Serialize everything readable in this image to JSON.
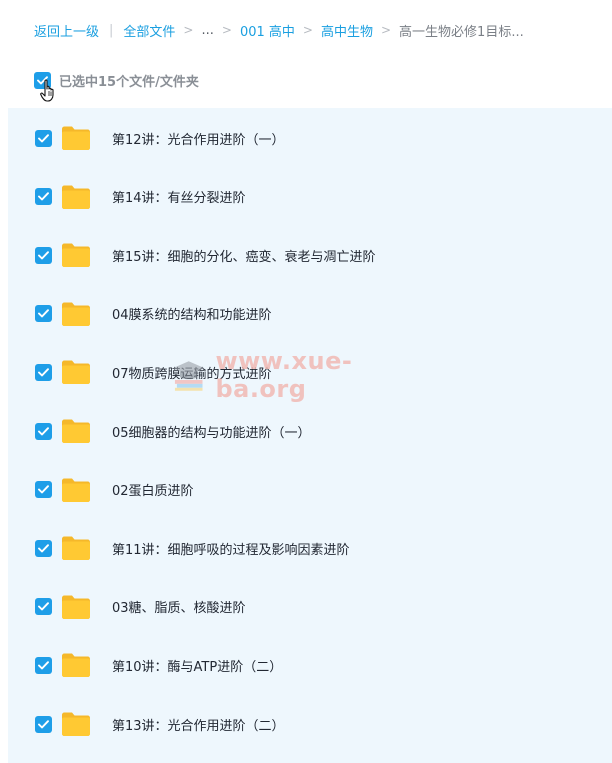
{
  "breadcrumb": {
    "back": "返回上一级",
    "items": [
      "全部文件",
      "...",
      "001 高中",
      "高中生物"
    ],
    "current": "高一生物必修1目标...",
    "separator": ">",
    "divider": "|"
  },
  "selection": {
    "text": "已选中15个文件/文件夹"
  },
  "files": [
    "第12讲：光合作用进阶（一）",
    "第14讲：有丝分裂进阶",
    "第15讲：细胞的分化、癌变、衰老与凋亡进阶",
    "04膜系统的结构和功能进阶",
    "07物质跨膜运输的方式进阶",
    "05细胞器的结构与功能进阶（一）",
    "02蛋白质进阶",
    "第11讲：细胞呼吸的过程及影响因素进阶",
    "03糖、脂质、核酸进阶",
    "第10讲：酶与ATP进阶（二）",
    "第13讲：光合作用进阶（二）"
  ],
  "watermark": "www.xue-ba.org",
  "colors": {
    "accent": "#1e9ee8",
    "list_bg": "#eef7fd",
    "folder": "#ffc933"
  },
  "icons": {
    "checkbox": "checkbox-checked-icon",
    "folder": "folder-icon",
    "cursor": "hand-cursor-icon"
  }
}
